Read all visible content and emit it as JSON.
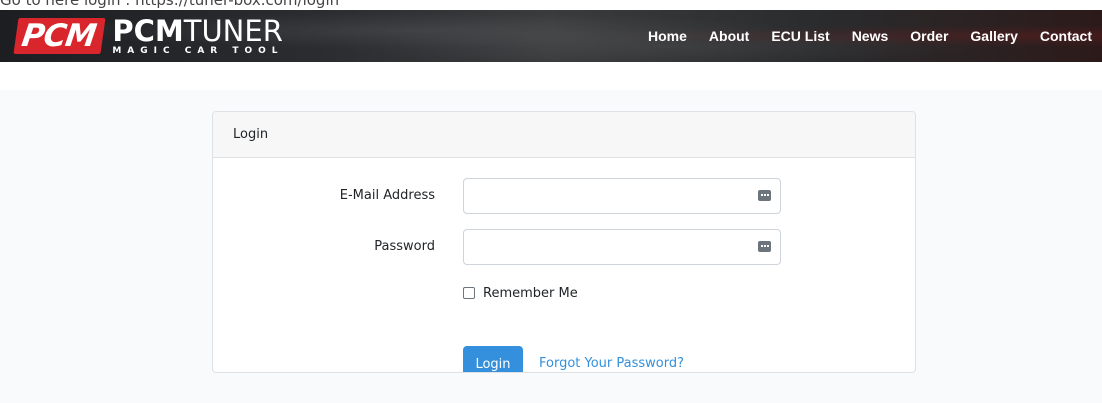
{
  "caption": "Go to here login : https://tuner-box.com/login",
  "brand": {
    "badge": "PCM",
    "name_strong": "PCM",
    "name_light": "TUNER",
    "tagline": "MAGIC CAR TOOL"
  },
  "nav": {
    "items": [
      {
        "label": "Home"
      },
      {
        "label": "About"
      },
      {
        "label": "ECU List"
      },
      {
        "label": "News"
      },
      {
        "label": "Order"
      },
      {
        "label": "Gallery"
      },
      {
        "label": "Contact"
      }
    ]
  },
  "login_card": {
    "header": "Login",
    "email_label": "E-Mail Address",
    "email_value": "",
    "password_label": "Password",
    "password_value": "",
    "remember_label": "Remember Me",
    "remember_checked": false,
    "login_button": "Login",
    "forgot_link": "Forgot Your Password?"
  },
  "colors": {
    "brand_red": "#d8262c",
    "primary": "#3490dc",
    "navbar": "#2b2d30",
    "page_background": "#f8fafc"
  },
  "icons": {
    "field_icon": "password-manager-key-icon"
  }
}
